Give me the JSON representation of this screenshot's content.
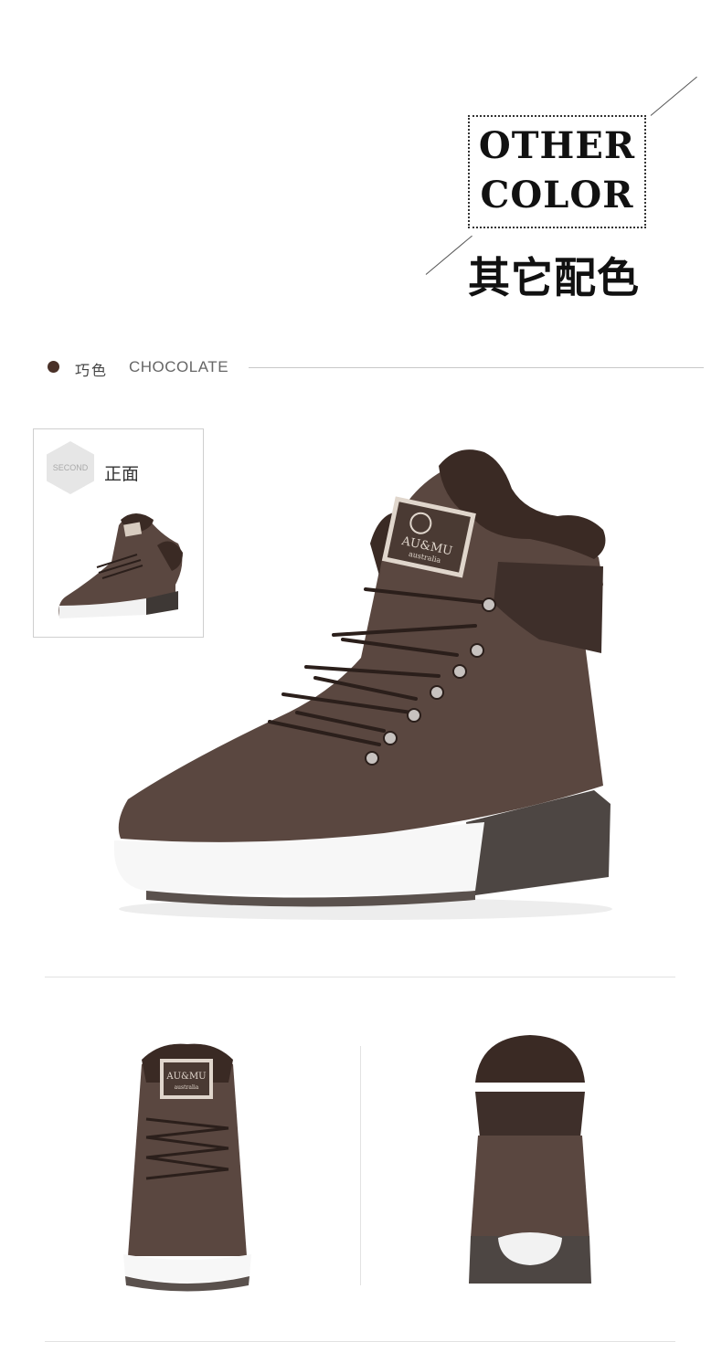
{
  "header": {
    "title_en_line1": "OTHER",
    "title_en_line2": "COLOR",
    "title_cn": "其它配色"
  },
  "color_row": {
    "name_cn": "巧色",
    "name_en": "CHOCOLATE",
    "dot_color": "#4a3128"
  },
  "thumbnail": {
    "badge": "SECOND",
    "label": "正面"
  },
  "main_product": {
    "logo_line1": "AU&MU",
    "logo_line2": "australia"
  },
  "front_product": {
    "logo_line1": "AU&MU",
    "logo_line2": "australia"
  },
  "colors": {
    "suede": "#5a4740",
    "suede_dark": "#3e2f2a",
    "fur": "#3a2a24",
    "sole_white": "#f5f5f5",
    "sole_dark": "#4d4643"
  }
}
